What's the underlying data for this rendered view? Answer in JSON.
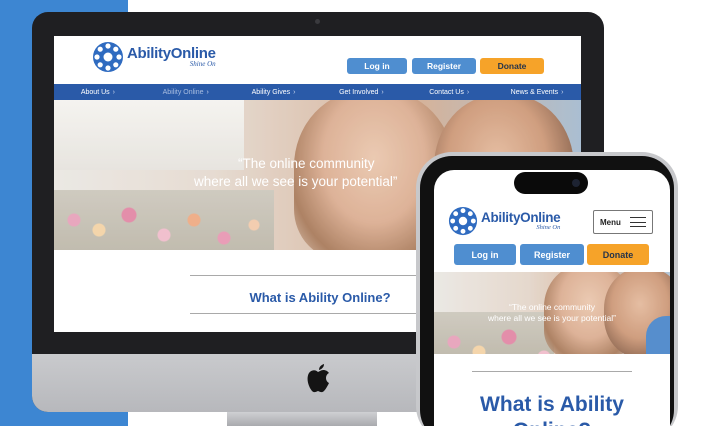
{
  "brand": {
    "name_prefix": "A",
    "name_rest": "bilityOnline",
    "tagline": "Shine On",
    "colors": {
      "primary": "#2a5aa8",
      "button": "#4f8ed0",
      "donate": "#f6a329",
      "backdrop": "#3d86d2"
    }
  },
  "header": {
    "login_label": "Log in",
    "register_label": "Register",
    "donate_label": "Donate"
  },
  "nav": {
    "items": [
      {
        "label": "About Us",
        "icon": "chevron-right-icon"
      },
      {
        "label": "Ability Online",
        "icon": "chevron-right-icon"
      },
      {
        "label": "Ability Gives",
        "icon": "chevron-right-icon"
      },
      {
        "label": "Get Involved",
        "icon": "chevron-right-icon"
      },
      {
        "label": "Contact Us",
        "icon": "chevron-right-icon"
      },
      {
        "label": "News & Events",
        "icon": "chevron-right-icon"
      }
    ]
  },
  "hero": {
    "desktop_line1": "“The online community",
    "desktop_line2": "where all we see is your potential”",
    "mobile_line1": "“The online community",
    "mobile_line2": "where all we see is your potential”"
  },
  "section": {
    "heading": "What is Ability Online?",
    "mobile_heading_line1": "What is Ability",
    "mobile_heading_line2": "Online?"
  },
  "mobile": {
    "menu_label": "Menu"
  },
  "icons": {
    "apple": "apple-logo-icon",
    "hamburger": "hamburger-menu-icon",
    "chevron": "chevron-right-icon"
  }
}
